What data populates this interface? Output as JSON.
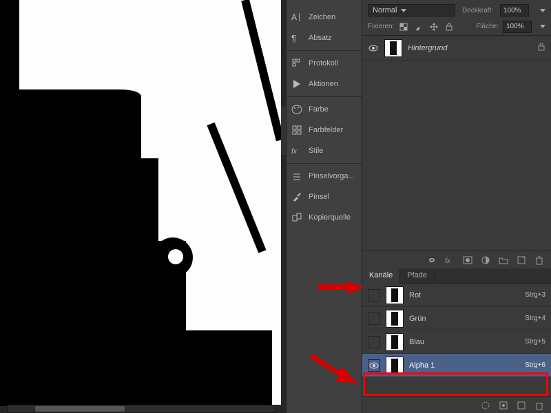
{
  "tool_panels": {
    "zeichen": "Zeichen",
    "absatz": "Absatz",
    "divider1": true,
    "protokoll": "Protokoll",
    "aktionen": "Aktionen",
    "divider2": true,
    "farbe": "Farbe",
    "farbfelder": "Farbfelder",
    "stile": "Stile",
    "divider3": true,
    "pinselvorga": "Pinselvorga...",
    "pinsel": "Pinsel",
    "kopierquelle": "Kopierquelle"
  },
  "layer_panel": {
    "blend_mode": "Normal",
    "opacity_label": "Deckkraft:",
    "opacity_value": "100%",
    "lock_label": "Fixieren:",
    "fill_label": "Fläche:",
    "fill_value": "100%",
    "background_layer": "Hintergrund"
  },
  "channels_panel": {
    "tab_kanale": "Kanäle",
    "tab_pfade": "Pfade",
    "rows": [
      {
        "name": "Rot",
        "key": "Strg+3",
        "visible": false,
        "selected": false
      },
      {
        "name": "Grün",
        "key": "Strg+4",
        "visible": false,
        "selected": false
      },
      {
        "name": "Blau",
        "key": "Strg+5",
        "visible": false,
        "selected": false
      },
      {
        "name": "Alpha 1",
        "key": "Strg+6",
        "visible": true,
        "selected": true
      }
    ]
  }
}
